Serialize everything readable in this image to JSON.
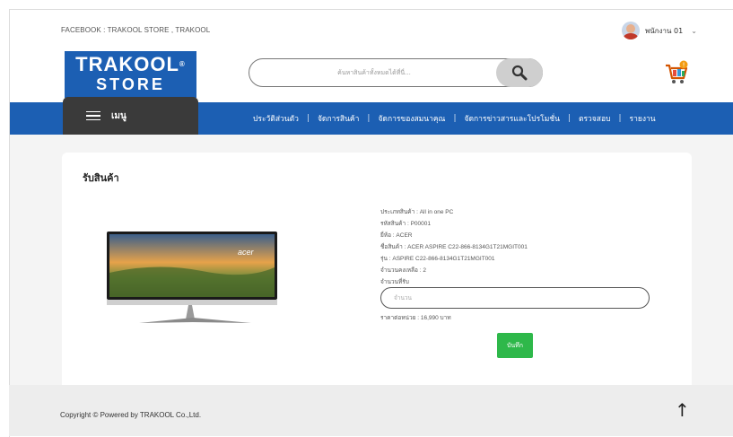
{
  "topbar": {
    "facebook": "FACEBOOK : TRAKOOL STORE , TRAKOOL",
    "user_name": "พนักงาน 01",
    "caret": "⌄"
  },
  "header": {
    "logo_line1": "TRAKOOL",
    "logo_reg": "®",
    "logo_line2": "STORE",
    "search_placeholder": "ค้นหาสินค้าทั้งหมดได้ที่นี่..."
  },
  "nav": {
    "menu_label": "เมนู",
    "links": [
      "ประวัติส่วนตัว",
      "จัดการสินค้า",
      "จัดการของสมนาคุณ",
      "จัดการข่าวสารและโปรโมชั่น",
      "ตรวจสอบ",
      "รายงาน"
    ],
    "separator": "|"
  },
  "page": {
    "title": "รับสินค้า",
    "product": {
      "type": "ประเภทสินค้า : All in one PC",
      "code": "รหัสสินค้า : P00001",
      "brand": "ยี่ห้อ : ACER",
      "name": "ชื่อสินค้า : ACER ASPIRE C22-866-8134G1T21MGIT001",
      "model": "รุ่น : ASPIRE C22-866-8134G1T21MGIT001",
      "remaining": "จำนวนคงเหลือ : 2",
      "receive_label": "จำนวนที่รับ",
      "qty_placeholder": "จำนวน",
      "price": "ราคาต่อหน่วย : 16,990 บาท",
      "image_brand": "acer"
    },
    "save_label": "บันทึก"
  },
  "footer": {
    "copyright": "Copyright © Powered by TRAKOOL Co.,Ltd.",
    "to_top": "↑"
  },
  "colors": {
    "brand_blue": "#1c5fb3",
    "menu_dark": "#3a3a3a",
    "save_green": "#2eb84a"
  },
  "icons": {
    "search": "search-icon",
    "cart": "cart-icon",
    "menu": "hamburger-icon",
    "avatar": "avatar-icon",
    "to_top": "arrow-up-icon"
  }
}
